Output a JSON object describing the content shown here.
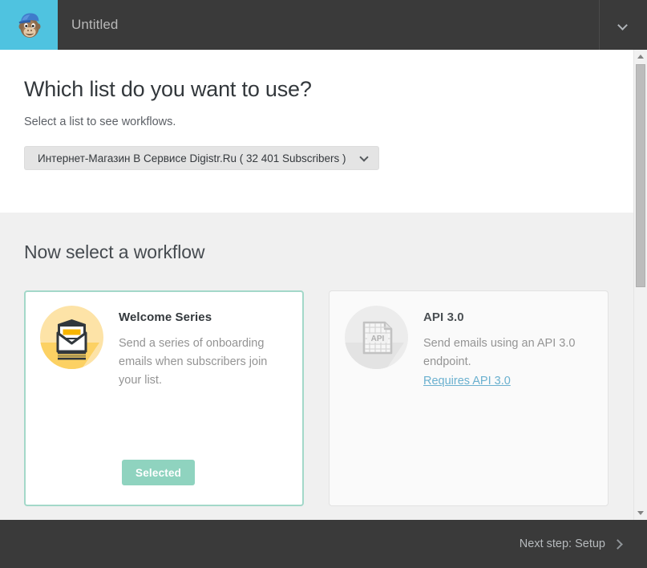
{
  "header": {
    "logo_icon": "mailchimp-freddie-logo",
    "title": "Untitled",
    "menu_icon": "chevron-down-icon"
  },
  "list_step": {
    "title": "Which list do you want to use?",
    "subtitle": "Select a list to see workflows.",
    "select": {
      "value": "Интернет-Магазин В Сервисе Digistr.Ru ( 32 401 Subscribers )",
      "caret_icon": "chevron-down-icon"
    }
  },
  "workflow_step": {
    "title": "Now select a workflow",
    "cards": [
      {
        "id": "welcome-series",
        "icon": "open-envelope-icon",
        "title": "Welcome Series",
        "description": "Send a series of onboarding emails when subscribers join your list.",
        "button_label": "Selected",
        "state": "selected",
        "link": null
      },
      {
        "id": "api-3-0",
        "icon": "api-document-icon",
        "icon_label": "API",
        "title": "API 3.0",
        "description": "Send emails using an API 3.0 endpoint.",
        "link": "Requires API 3.0",
        "state": "disabled",
        "button_label": null
      }
    ]
  },
  "footer": {
    "next_label": "Next step: Setup",
    "next_icon": "chevron-right-icon"
  },
  "scrollbar": {
    "up_icon": "scroll-up-arrow-icon",
    "down_icon": "scroll-down-arrow-icon"
  },
  "colors": {
    "brand_cyan": "#4fc3e0",
    "header_dark": "#3a3a3a",
    "selected_teal": "#8fd3bf",
    "card_border_teal": "#a3d8c9",
    "link_blue": "#6ab0cf",
    "panel_grey": "#f0f0f0"
  }
}
